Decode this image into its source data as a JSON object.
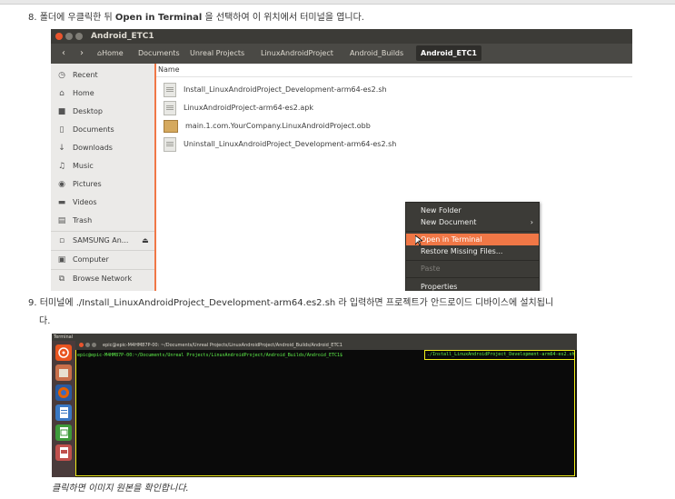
{
  "step8": {
    "number": "8.",
    "text_before": "폴더에 우클릭한 뒤",
    "bold": "Open in Terminal",
    "text_after": "을 선택하여 이 위치에서 터미널을 엽니다."
  },
  "nautilus": {
    "window_title": "Android_ETC1",
    "breadcrumbs": [
      "Home",
      "Documents",
      "Unreal Projects",
      "LinuxAndroidProject",
      "Android_Builds",
      "Android_ETC1"
    ],
    "sidebar": [
      {
        "icon": "clock-icon",
        "label": "Recent"
      },
      {
        "icon": "home-icon",
        "label": "Home"
      },
      {
        "icon": "desktop-icon",
        "label": "Desktop"
      },
      {
        "icon": "document-icon",
        "label": "Documents"
      },
      {
        "icon": "download-icon",
        "label": "Downloads"
      },
      {
        "icon": "music-icon",
        "label": "Music"
      },
      {
        "icon": "camera-icon",
        "label": "Pictures"
      },
      {
        "icon": "video-icon",
        "label": "Videos"
      },
      {
        "icon": "trash-icon",
        "label": "Trash"
      },
      {
        "icon": "drive-icon",
        "label": "SAMSUNG An..."
      },
      {
        "icon": "computer-icon",
        "label": "Computer"
      },
      {
        "icon": "network-icon",
        "label": "Browse Network"
      }
    ],
    "column_header": "Name",
    "files": [
      "Install_LinuxAndroidProject_Development-arm64-es2.sh",
      "LinuxAndroidProject-arm64-es2.apk",
      "main.1.com.YourCompany.LinuxAndroidProject.obb",
      "Uninstall_LinuxAndroidProject_Development-arm64-es2.sh"
    ],
    "context_menu": [
      "New Folder",
      "New Document",
      "Open in Terminal",
      "Restore Missing Files...",
      "Paste",
      "Properties"
    ],
    "accent_color": "#f07746"
  },
  "step9": {
    "number": "9.",
    "text": "터미널에 ./Install_LinuxAndroidProject_Development-arm64.es2.sh 라 입력하면 프로젝트가 안드로이드 디바이스에 설치됩니",
    "text_cont": "다."
  },
  "terminal": {
    "app_label": "Terminal",
    "window_title": "epic@epic-M4HM87P-00: ~/Documents/Unreal Projects/LinuxAndroidProject/Android_Builds/Android_ETC1",
    "prompt": "epic@epic-M4HM87P-00:~/Documents/Unreal Projects/LinuxAndroidProject/Android_Builds/Android_ETC1$",
    "command": "./Install_LinuxAndroidProject_Development-arm64-es2.sh",
    "highlight_color": "#f0ec1a"
  },
  "caption": "클릭하면 이미지 원본을 확인합니다."
}
